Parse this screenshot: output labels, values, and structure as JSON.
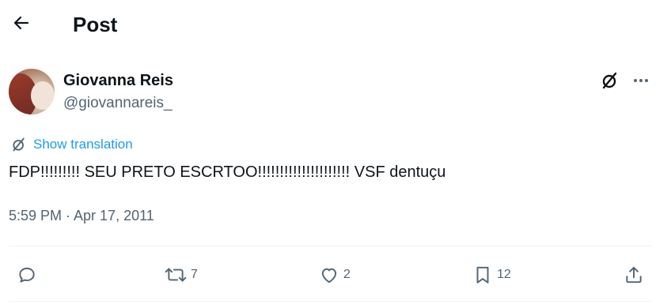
{
  "header": {
    "title": "Post"
  },
  "author": {
    "display_name": "Giovanna Reis",
    "handle": "@giovannareis_"
  },
  "translation": {
    "label": "Show translation"
  },
  "tweet": {
    "text": "FDP!!!!!!!!! SEU PRETO ESCRTOO!!!!!!!!!!!!!!!!!!!!! VSF dentuçu"
  },
  "meta": {
    "timestamp": "5:59 PM · Apr 17, 2011"
  },
  "actions": {
    "reposts": "7",
    "likes": "2",
    "bookmarks": "12"
  },
  "colors": {
    "accent": "#1d9bf0",
    "text": "#0f1419",
    "secondary": "#536471",
    "divider": "#eff3f4"
  },
  "icons": [
    "back-arrow-icon",
    "grok-icon",
    "more-icon",
    "translate-icon",
    "reply-icon",
    "repost-icon",
    "like-icon",
    "bookmark-icon",
    "share-icon"
  ]
}
